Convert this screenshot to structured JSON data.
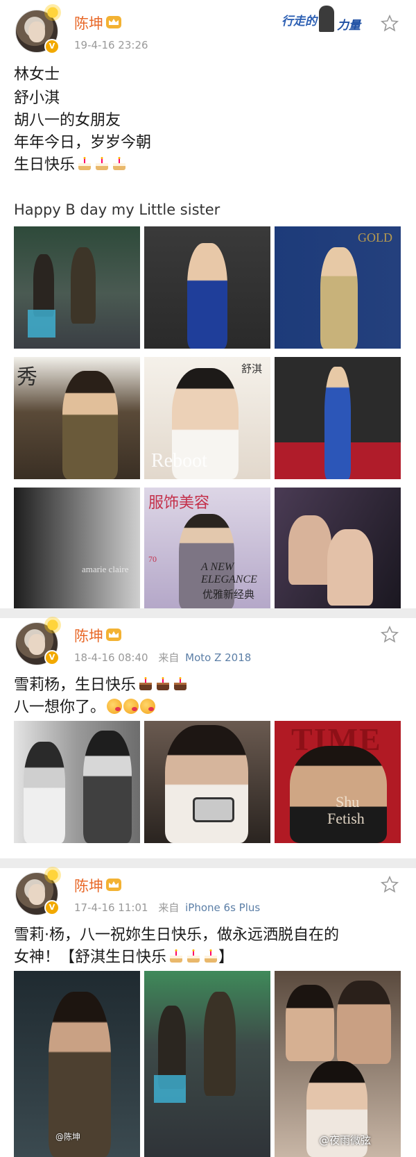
{
  "posts": [
    {
      "username": "陈坤",
      "timestamp": "19-4-16 23:26",
      "lines": [
        "林女士",
        "舒小淇",
        "胡八一的女朋友",
        "年年今日，岁岁今朝",
        "生日快乐"
      ],
      "english_line": "Happy B day my Little sister",
      "photo_captions": [
        "秀",
        "舒淇",
        "Reboot",
        "amarie claire",
        "服饰美容",
        "A NEW ELEGANCE",
        "优雅新经典",
        "70"
      ]
    },
    {
      "username": "陈坤",
      "timestamp": "18-4-16 08:40",
      "from_label": "来自",
      "source": "Moto Z 2018",
      "lines": [
        "雪莉杨，生日快乐",
        "八一想你了。"
      ],
      "photo_captions": [
        "TIME",
        "Shu",
        "Fetish"
      ]
    },
    {
      "username": "陈坤",
      "timestamp": "17-4-16 11:01",
      "from_label": "来自",
      "source": "iPhone 6s Plus",
      "lines": [
        "雪莉·杨，八一祝妳生日快乐，做永远洒脱自在的",
        "女神！【舒淇生日快乐",
        "】"
      ]
    }
  ],
  "banner": {
    "part1": "行走的",
    "part2": "力量"
  },
  "watermark": "@夜雨微弦",
  "weibo_watermark": "@陈坤",
  "colors": {
    "username": "#e8692a",
    "meta": "#999999",
    "source_link": "#5b7ea6",
    "vip": "#f2a900"
  },
  "icons": [
    "vip-badge-icon",
    "crown-icon",
    "star-icon",
    "cake-icon",
    "kiss-face-icon",
    "sun-icon"
  ]
}
